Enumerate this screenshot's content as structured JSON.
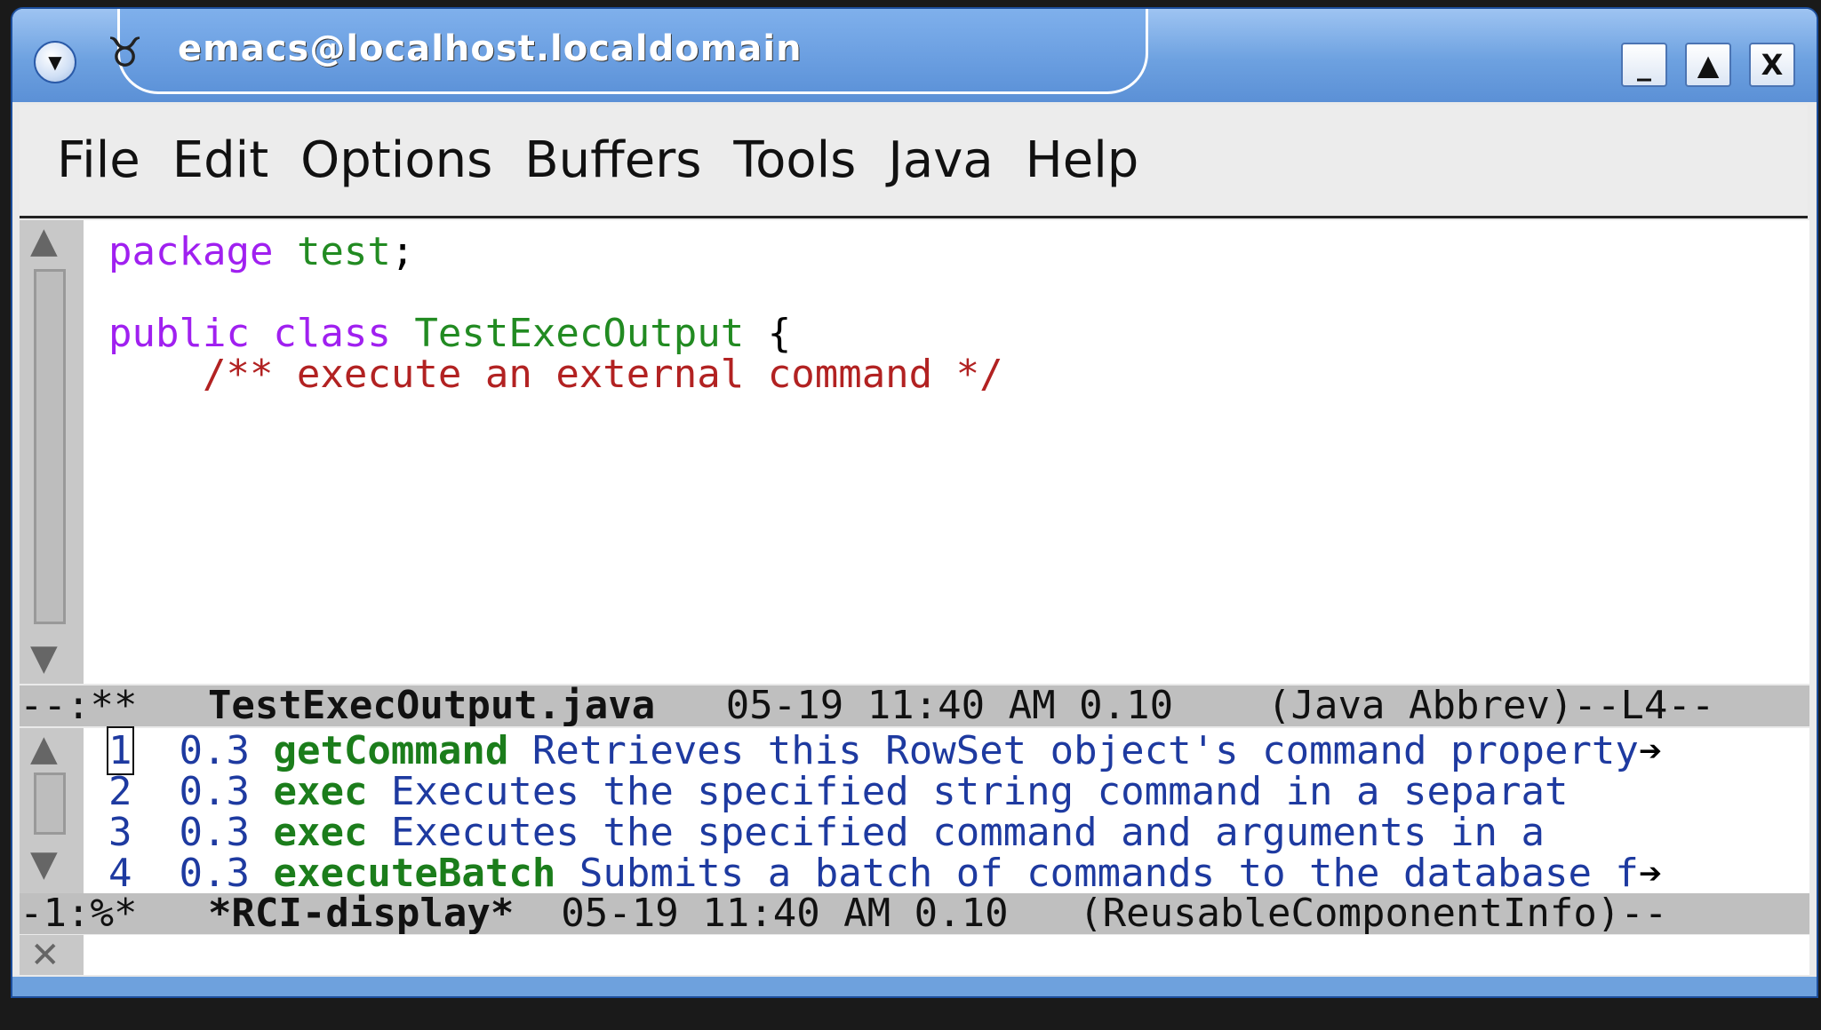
{
  "window": {
    "title": "emacs@localhost.localdomain",
    "app_icon": "gnu-emacs-icon",
    "controls": {
      "minimize": "_",
      "maximize": "▲",
      "close": "X"
    }
  },
  "menubar": [
    "File",
    "Edit",
    "Options",
    "Buffers",
    "Tools",
    "Java",
    "Help"
  ],
  "editor": {
    "line1": {
      "kw": "package",
      "name": "test",
      "punct": ";"
    },
    "line3": {
      "kw": "public class",
      "type": "TestExecOutput",
      "punct": "{"
    },
    "line4": {
      "comment": "    /** execute an external command */"
    }
  },
  "modeline_top": {
    "status": "--:**",
    "buffer": "TestExecOutput.java",
    "info": "05-19 11:40 AM 0.10",
    "mode": "(Java Abbrev)--L4--"
  },
  "completions": [
    {
      "n": "1",
      "score": "0.3",
      "method": "getCommand",
      "desc": "Retrieves this RowSet object's command property",
      "more": "➔"
    },
    {
      "n": "2",
      "score": "0.3",
      "method": "exec",
      "desc": "Executes the specified string command in a separat",
      "more": ""
    },
    {
      "n": "3",
      "score": "0.3",
      "method": "exec",
      "desc": "Executes the specified command and arguments in a",
      "more": ""
    },
    {
      "n": "4",
      "score": "0.3",
      "method": "executeBatch",
      "desc": "Submits a batch of commands to the database f",
      "more": "➔"
    }
  ],
  "modeline_bottom": {
    "status": "-1:%*",
    "buffer": "*RCI-display*",
    "info": "05-19 11:40 AM 0.10",
    "mode": "(ReusableComponentInfo)--"
  }
}
